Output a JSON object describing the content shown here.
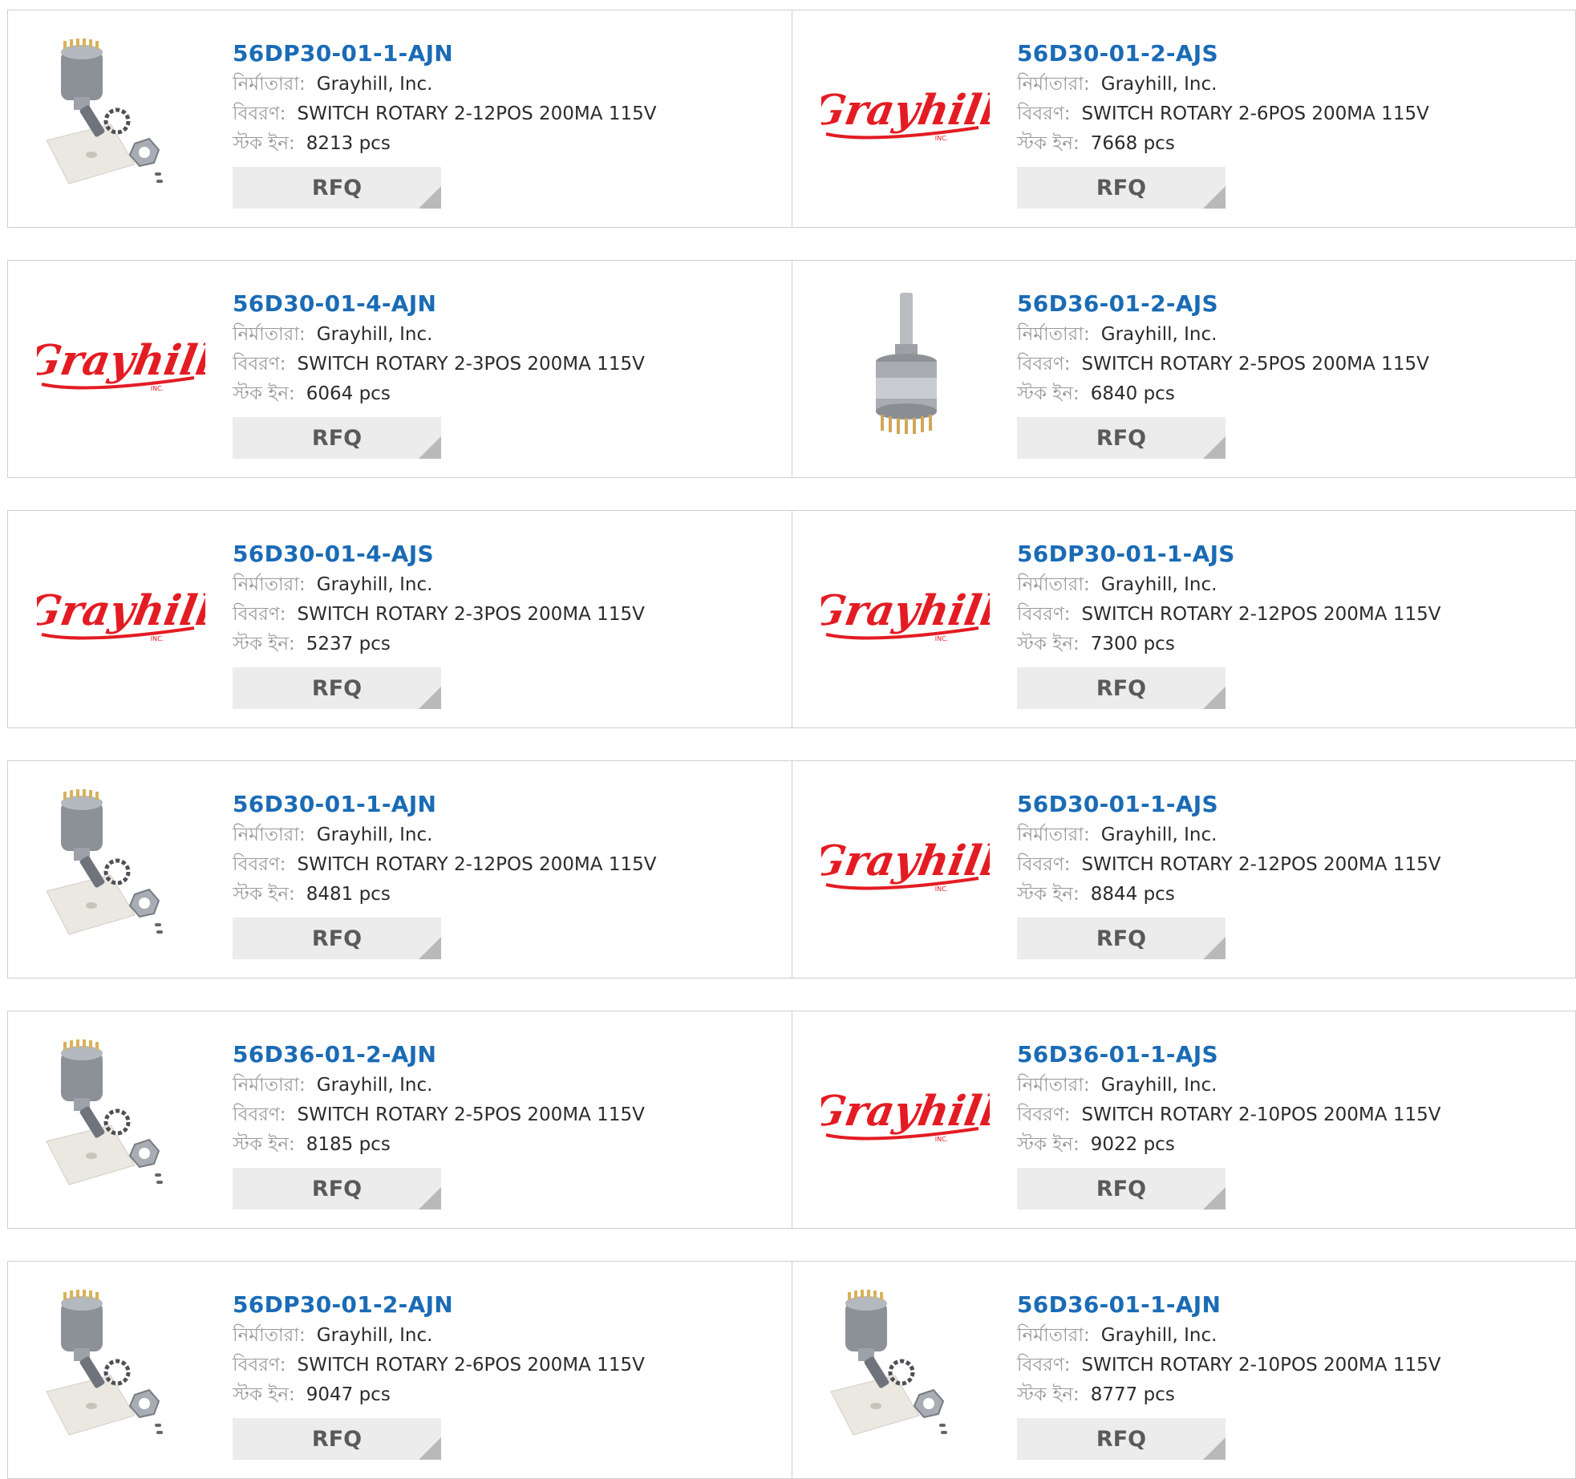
{
  "labels": {
    "manufacturer": "নির্মাতারা:",
    "description": "বিবরণ:",
    "stock": "স্টক ইন:",
    "rfq": "RFQ"
  },
  "logo_text": "Grayhill",
  "logo_sub": "INC.",
  "colors": {
    "part_number": "#1a6bb5",
    "logo_red": "#e31c23",
    "rfq_bg": "#ececec"
  },
  "products": [
    {
      "part_number": "56DP30-01-1-AJN",
      "manufacturer": "Grayhill, Inc.",
      "description": "SWITCH ROTARY 2-12POS 200MA 115V",
      "stock": "8213 pcs",
      "image": "rotary-switch-kit-photo"
    },
    {
      "part_number": "56D30-01-2-AJS",
      "manufacturer": "Grayhill, Inc.",
      "description": "SWITCH ROTARY 2-6POS 200MA 115V",
      "stock": "7668 pcs",
      "image": "grayhill-logo"
    },
    {
      "part_number": "56D30-01-4-AJN",
      "manufacturer": "Grayhill, Inc.",
      "description": "SWITCH ROTARY 2-3POS 200MA 115V",
      "stock": "6064 pcs",
      "image": "grayhill-logo"
    },
    {
      "part_number": "56D36-01-2-AJS",
      "manufacturer": "Grayhill, Inc.",
      "description": "SWITCH ROTARY 2-5POS 200MA 115V",
      "stock": "6840 pcs",
      "image": "rotary-switch-photo"
    },
    {
      "part_number": "56D30-01-4-AJS",
      "manufacturer": "Grayhill, Inc.",
      "description": "SWITCH ROTARY 2-3POS 200MA 115V",
      "stock": "5237 pcs",
      "image": "grayhill-logo"
    },
    {
      "part_number": "56DP30-01-1-AJS",
      "manufacturer": "Grayhill, Inc.",
      "description": "SWITCH ROTARY 2-12POS 200MA 115V",
      "stock": "7300 pcs",
      "image": "grayhill-logo"
    },
    {
      "part_number": "56D30-01-1-AJN",
      "manufacturer": "Grayhill, Inc.",
      "description": "SWITCH ROTARY 2-12POS 200MA 115V",
      "stock": "8481 pcs",
      "image": "rotary-switch-kit-photo"
    },
    {
      "part_number": "56D30-01-1-AJS",
      "manufacturer": "Grayhill, Inc.",
      "description": "SWITCH ROTARY 2-12POS 200MA 115V",
      "stock": "8844 pcs",
      "image": "grayhill-logo"
    },
    {
      "part_number": "56D36-01-2-AJN",
      "manufacturer": "Grayhill, Inc.",
      "description": "SWITCH ROTARY 2-5POS 200MA 115V",
      "stock": "8185 pcs",
      "image": "rotary-switch-kit-photo"
    },
    {
      "part_number": "56D36-01-1-AJS",
      "manufacturer": "Grayhill, Inc.",
      "description": "SWITCH ROTARY 2-10POS 200MA 115V",
      "stock": "9022 pcs",
      "image": "grayhill-logo"
    },
    {
      "part_number": "56DP30-01-2-AJN",
      "manufacturer": "Grayhill, Inc.",
      "description": "SWITCH ROTARY 2-6POS 200MA 115V",
      "stock": "9047 pcs",
      "image": "rotary-switch-kit-photo"
    },
    {
      "part_number": "56D36-01-1-AJN",
      "manufacturer": "Grayhill, Inc.",
      "description": "SWITCH ROTARY 2-10POS 200MA 115V",
      "stock": "8777 pcs",
      "image": "rotary-switch-kit-photo"
    }
  ]
}
